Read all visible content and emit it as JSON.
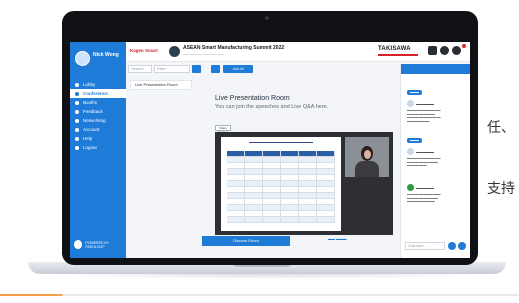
{
  "side_text": [
    "任、",
    "支持"
  ],
  "nav": {
    "user_name": "Nick Wong",
    "items": [
      {
        "label": "Lobby",
        "active": false
      },
      {
        "label": "Conference",
        "active": true
      },
      {
        "label": "Booths",
        "active": false
      },
      {
        "label": "Feedback",
        "active": false
      },
      {
        "label": "Networking",
        "active": false
      },
      {
        "label": "Account",
        "active": false
      },
      {
        "label": "Help",
        "active": false
      },
      {
        "label": "Logout",
        "active": false
      }
    ],
    "footer": "POWERED BY PAEOLOOP"
  },
  "banner": {
    "org": "Kagen Smart",
    "title": "ASEAN Smart Manufacturing Summit 2022",
    "sponsor": "TAKISAWA"
  },
  "searchbar": {
    "search_placeholder": "Search",
    "filter_value": "Filter",
    "session_button": "Join All"
  },
  "sessions": [
    "Live Presentation Room"
  ],
  "main": {
    "title": "Live Presentation Room",
    "subtitle": "You can join the speeches and Live Q&A here.",
    "share_button": "Share Screen"
  },
  "chat_button": "Discuss Room",
  "chat": {
    "input_placeholder": "Chat here..."
  },
  "colors": {
    "brand_blue": "#1e7bd7",
    "accent_orange": "#f6a04d"
  }
}
